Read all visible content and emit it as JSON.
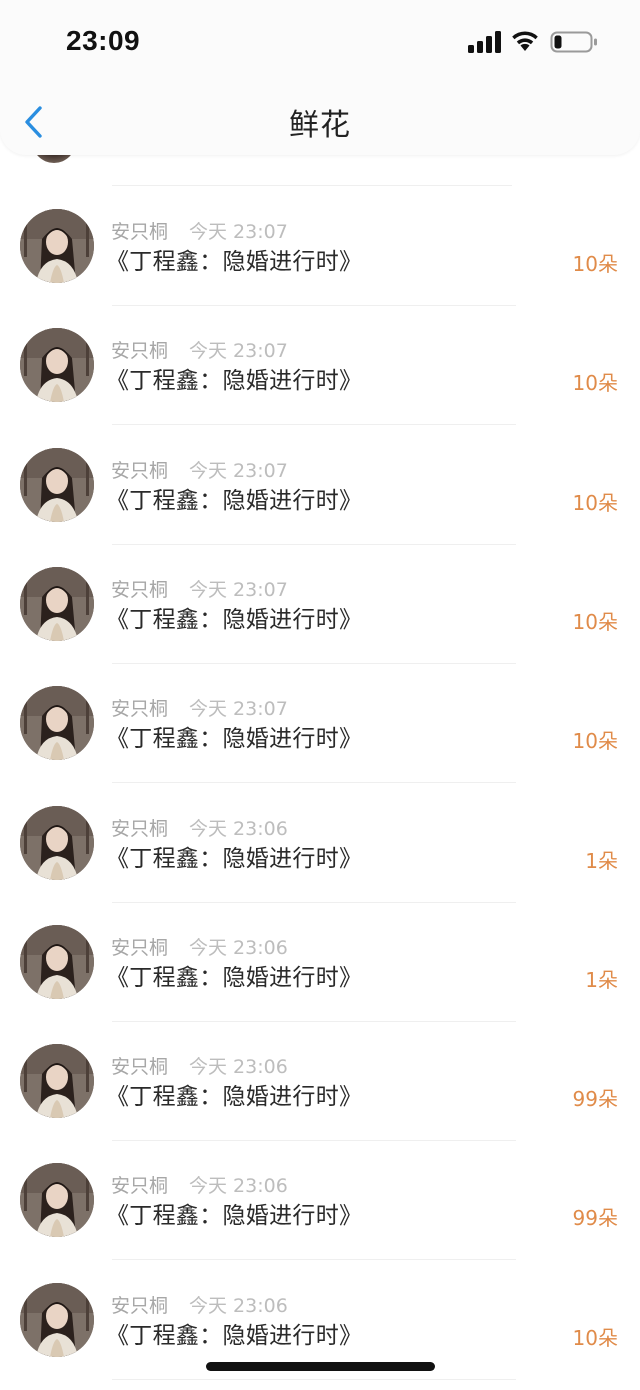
{
  "status_bar": {
    "time": "23:09",
    "signal_icon": "cellular-signal-icon",
    "wifi_icon": "wifi-icon",
    "battery_icon": "battery-low-icon"
  },
  "nav": {
    "back_icon": "chevron-left-icon",
    "title": "鲜花"
  },
  "colors": {
    "accent_back": "#2a8ee0",
    "count_orange": "#e08b49",
    "name_gray": "#a7a7a7",
    "time_gray": "#bdbdbd"
  },
  "items": [
    {
      "name": "安只桐",
      "time": "今天 23:07",
      "title": "《丁程鑫：隐婚进行时》",
      "count": "10朵"
    },
    {
      "name": "安只桐",
      "time": "今天 23:07",
      "title": "《丁程鑫：隐婚进行时》",
      "count": "10朵"
    },
    {
      "name": "安只桐",
      "time": "今天 23:07",
      "title": "《丁程鑫：隐婚进行时》",
      "count": "10朵"
    },
    {
      "name": "安只桐",
      "time": "今天 23:07",
      "title": "《丁程鑫：隐婚进行时》",
      "count": "10朵"
    },
    {
      "name": "安只桐",
      "time": "今天 23:07",
      "title": "《丁程鑫：隐婚进行时》",
      "count": "10朵"
    },
    {
      "name": "安只桐",
      "time": "今天 23:06",
      "title": "《丁程鑫：隐婚进行时》",
      "count": "1朵"
    },
    {
      "name": "安只桐",
      "time": "今天 23:06",
      "title": "《丁程鑫：隐婚进行时》",
      "count": "1朵"
    },
    {
      "name": "安只桐",
      "time": "今天 23:06",
      "title": "《丁程鑫：隐婚进行时》",
      "count": "99朵"
    },
    {
      "name": "安只桐",
      "time": "今天 23:06",
      "title": "《丁程鑫：隐婚进行时》",
      "count": "99朵"
    },
    {
      "name": "安只桐",
      "time": "今天 23:06",
      "title": "《丁程鑫：隐婚进行时》",
      "count": "10朵"
    }
  ]
}
